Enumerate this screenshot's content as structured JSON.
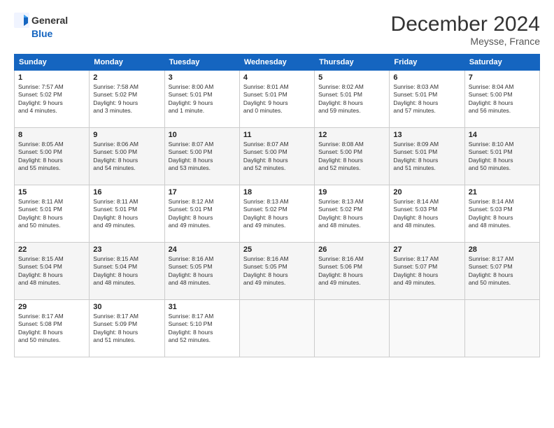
{
  "header": {
    "logo_line1": "General",
    "logo_line2": "Blue",
    "month": "December 2024",
    "location": "Meysse, France"
  },
  "weekdays": [
    "Sunday",
    "Monday",
    "Tuesday",
    "Wednesday",
    "Thursday",
    "Friday",
    "Saturday"
  ],
  "weeks": [
    [
      {
        "day": "1",
        "info": "Sunrise: 7:57 AM\nSunset: 5:02 PM\nDaylight: 9 hours\nand 4 minutes."
      },
      {
        "day": "2",
        "info": "Sunrise: 7:58 AM\nSunset: 5:02 PM\nDaylight: 9 hours\nand 3 minutes."
      },
      {
        "day": "3",
        "info": "Sunrise: 8:00 AM\nSunset: 5:01 PM\nDaylight: 9 hours\nand 1 minute."
      },
      {
        "day": "4",
        "info": "Sunrise: 8:01 AM\nSunset: 5:01 PM\nDaylight: 9 hours\nand 0 minutes."
      },
      {
        "day": "5",
        "info": "Sunrise: 8:02 AM\nSunset: 5:01 PM\nDaylight: 8 hours\nand 59 minutes."
      },
      {
        "day": "6",
        "info": "Sunrise: 8:03 AM\nSunset: 5:01 PM\nDaylight: 8 hours\nand 57 minutes."
      },
      {
        "day": "7",
        "info": "Sunrise: 8:04 AM\nSunset: 5:00 PM\nDaylight: 8 hours\nand 56 minutes."
      }
    ],
    [
      {
        "day": "8",
        "info": "Sunrise: 8:05 AM\nSunset: 5:00 PM\nDaylight: 8 hours\nand 55 minutes."
      },
      {
        "day": "9",
        "info": "Sunrise: 8:06 AM\nSunset: 5:00 PM\nDaylight: 8 hours\nand 54 minutes."
      },
      {
        "day": "10",
        "info": "Sunrise: 8:07 AM\nSunset: 5:00 PM\nDaylight: 8 hours\nand 53 minutes."
      },
      {
        "day": "11",
        "info": "Sunrise: 8:07 AM\nSunset: 5:00 PM\nDaylight: 8 hours\nand 52 minutes."
      },
      {
        "day": "12",
        "info": "Sunrise: 8:08 AM\nSunset: 5:00 PM\nDaylight: 8 hours\nand 52 minutes."
      },
      {
        "day": "13",
        "info": "Sunrise: 8:09 AM\nSunset: 5:01 PM\nDaylight: 8 hours\nand 51 minutes."
      },
      {
        "day": "14",
        "info": "Sunrise: 8:10 AM\nSunset: 5:01 PM\nDaylight: 8 hours\nand 50 minutes."
      }
    ],
    [
      {
        "day": "15",
        "info": "Sunrise: 8:11 AM\nSunset: 5:01 PM\nDaylight: 8 hours\nand 50 minutes."
      },
      {
        "day": "16",
        "info": "Sunrise: 8:11 AM\nSunset: 5:01 PM\nDaylight: 8 hours\nand 49 minutes."
      },
      {
        "day": "17",
        "info": "Sunrise: 8:12 AM\nSunset: 5:01 PM\nDaylight: 8 hours\nand 49 minutes."
      },
      {
        "day": "18",
        "info": "Sunrise: 8:13 AM\nSunset: 5:02 PM\nDaylight: 8 hours\nand 49 minutes."
      },
      {
        "day": "19",
        "info": "Sunrise: 8:13 AM\nSunset: 5:02 PM\nDaylight: 8 hours\nand 48 minutes."
      },
      {
        "day": "20",
        "info": "Sunrise: 8:14 AM\nSunset: 5:03 PM\nDaylight: 8 hours\nand 48 minutes."
      },
      {
        "day": "21",
        "info": "Sunrise: 8:14 AM\nSunset: 5:03 PM\nDaylight: 8 hours\nand 48 minutes."
      }
    ],
    [
      {
        "day": "22",
        "info": "Sunrise: 8:15 AM\nSunset: 5:04 PM\nDaylight: 8 hours\nand 48 minutes."
      },
      {
        "day": "23",
        "info": "Sunrise: 8:15 AM\nSunset: 5:04 PM\nDaylight: 8 hours\nand 48 minutes."
      },
      {
        "day": "24",
        "info": "Sunrise: 8:16 AM\nSunset: 5:05 PM\nDaylight: 8 hours\nand 48 minutes."
      },
      {
        "day": "25",
        "info": "Sunrise: 8:16 AM\nSunset: 5:05 PM\nDaylight: 8 hours\nand 49 minutes."
      },
      {
        "day": "26",
        "info": "Sunrise: 8:16 AM\nSunset: 5:06 PM\nDaylight: 8 hours\nand 49 minutes."
      },
      {
        "day": "27",
        "info": "Sunrise: 8:17 AM\nSunset: 5:07 PM\nDaylight: 8 hours\nand 49 minutes."
      },
      {
        "day": "28",
        "info": "Sunrise: 8:17 AM\nSunset: 5:07 PM\nDaylight: 8 hours\nand 50 minutes."
      }
    ],
    [
      {
        "day": "29",
        "info": "Sunrise: 8:17 AM\nSunset: 5:08 PM\nDaylight: 8 hours\nand 50 minutes."
      },
      {
        "day": "30",
        "info": "Sunrise: 8:17 AM\nSunset: 5:09 PM\nDaylight: 8 hours\nand 51 minutes."
      },
      {
        "day": "31",
        "info": "Sunrise: 8:17 AM\nSunset: 5:10 PM\nDaylight: 8 hours\nand 52 minutes."
      },
      null,
      null,
      null,
      null
    ]
  ]
}
